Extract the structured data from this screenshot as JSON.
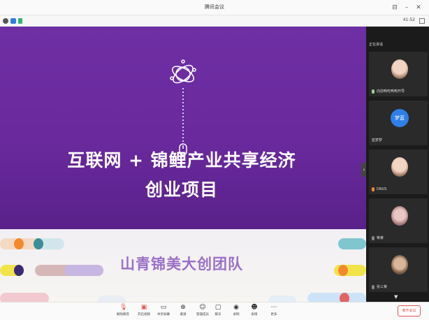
{
  "window": {
    "title": "腾讯会议"
  },
  "infobar": {
    "timer": "41:52"
  },
  "slide": {
    "headline_line1": "互联网 + 锦鲤产业共享经济",
    "headline_line2": "创业项目",
    "team": "山青锦美大创团队"
  },
  "panel": {
    "header": "正在讲话",
    "participants": [
      {
        "name": "向前鸭吃鸭鸭开导"
      },
      {
        "name": "蓝梦梦",
        "avatar_text": "梦蓝"
      },
      {
        "name": "DNUS"
      },
      {
        "name": "等某"
      },
      {
        "name": "张三某"
      }
    ]
  },
  "toolbar": {
    "items": [
      {
        "label": "解除静音",
        "icon": "mic-icon"
      },
      {
        "label": "开启视频",
        "icon": "camera-icon"
      },
      {
        "label": "共享屏幕",
        "icon": "screen-share-icon"
      },
      {
        "label": "邀请",
        "icon": "invite-icon"
      },
      {
        "label": "管理成员",
        "icon": "members-icon"
      },
      {
        "label": "聊天",
        "icon": "chat-icon"
      },
      {
        "label": "录制",
        "icon": "record-icon"
      },
      {
        "label": "表情",
        "icon": "emoji-icon"
      },
      {
        "label": "更多",
        "icon": "more-icon"
      }
    ],
    "leave": "离开会议"
  },
  "colors": {
    "slide_purple": "#6f2fa4",
    "leave_red": "#e05454",
    "avatar_blue": "#2f7fe6"
  }
}
